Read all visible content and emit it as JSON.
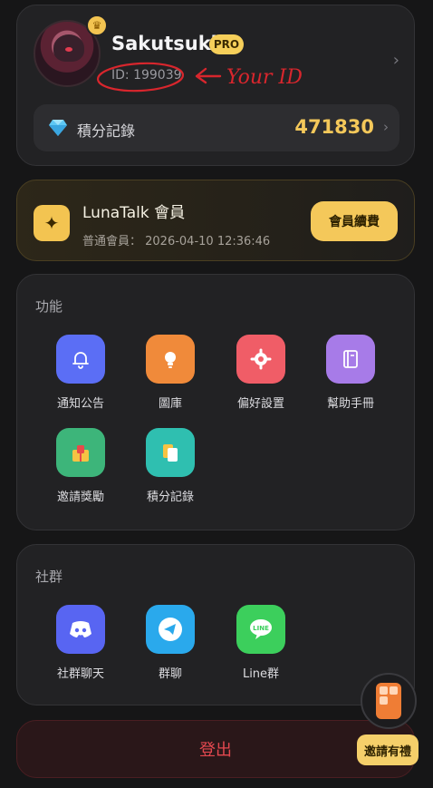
{
  "profile": {
    "username": "Sakutsuki",
    "badge": "PRO",
    "user_id": "ID: 199039",
    "annotation": "Your ID",
    "points_label": "積分記錄",
    "points_value": "471830"
  },
  "membership": {
    "title": "LunaTalk 會員",
    "subtitle": "普通會員： 2026-04-10 12:36:46",
    "renew_label": "會員續費"
  },
  "features": {
    "title": "功能",
    "items": [
      {
        "label": "通知公告",
        "icon": "bell-icon",
        "color": "#5b6ef5"
      },
      {
        "label": "圖庫",
        "icon": "bulb-icon",
        "color": "#f08a3a"
      },
      {
        "label": "偏好設置",
        "icon": "gear-icon",
        "color": "#f05d67"
      },
      {
        "label": "幫助手冊",
        "icon": "book-icon",
        "color": "#a77be8"
      },
      {
        "label": "邀請獎勵",
        "icon": "gift-icon",
        "color": "#3db57a"
      },
      {
        "label": "積分記錄",
        "icon": "cards-icon",
        "color": "#2fbfb0"
      }
    ]
  },
  "social": {
    "title": "社群",
    "items": [
      {
        "label": "社群聊天",
        "icon": "discord-icon",
        "color": "#5865f2"
      },
      {
        "label": "群聊",
        "icon": "telegram-icon",
        "color": "#2aa9ec"
      },
      {
        "label": "Line群",
        "icon": "line-icon",
        "color": "#3ccf5c"
      }
    ]
  },
  "logout_label": "登出",
  "invite_label": "邀請有禮",
  "colors": {
    "accent_gold": "#f4c85a",
    "logout_red": "#e3484f",
    "annotation_red": "#d8262d"
  }
}
